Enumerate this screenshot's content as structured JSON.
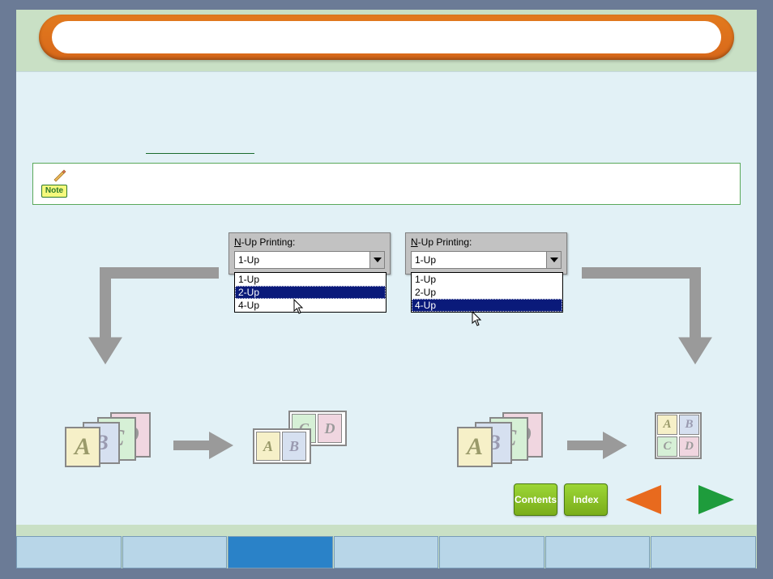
{
  "note_label": "Note",
  "dropdown": {
    "prefix": "N",
    "label_rest": "-Up Printing:",
    "display": "1-Up",
    "options": [
      "1-Up",
      "2-Up",
      "4-Up"
    ]
  },
  "selection_left_index": 1,
  "selection_right_index": 2,
  "letters": [
    "A",
    "B",
    "C",
    "D"
  ],
  "nav": {
    "contents": "Contents",
    "index": "Index"
  },
  "tabs_count": 7,
  "tabs_active_index": 2
}
